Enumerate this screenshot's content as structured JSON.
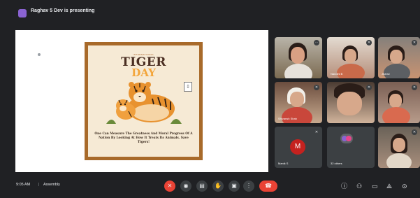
{
  "header": {
    "presenting_text": "Raghav 5 Dev is presenting"
  },
  "slide": {
    "poster_subtitle": "INTERNATIONAL",
    "poster_title_line1": "TIGER",
    "poster_title_line2": "DAY",
    "poster_caption": "One Can Measure The Greatness And Moral Progress Of A Nation By Looking At How It Treats Its Animals. Save Tigers!",
    "badge_icon": "slide-page-icon"
  },
  "participants": [
    {
      "name": "",
      "icon": "more-icon"
    },
    {
      "name": "Nandini B",
      "icon": "mic-off-icon"
    },
    {
      "name": "Jhanvi",
      "icon": "mic-off-icon"
    },
    {
      "name": "Shivansh Shah",
      "icon": "mic-off-icon"
    },
    {
      "name": "",
      "icon": "mic-off-icon"
    },
    {
      "name": "",
      "icon": "mic-off-icon"
    },
    {
      "name": "Manik S",
      "avatar_letter": "M",
      "icon": "mic-off-icon"
    },
    {
      "name": "32 others",
      "icon": "others-icon"
    },
    {
      "name": "",
      "icon": "mic-off-icon"
    }
  ],
  "footer": {
    "time": "9:05 AM",
    "separator": "|",
    "meeting_name": "Assembly"
  },
  "controls": [
    {
      "name": "mic-off-icon",
      "glyph": "✕"
    },
    {
      "name": "camera-icon",
      "glyph": "◉"
    },
    {
      "name": "captions-icon",
      "glyph": "▤"
    },
    {
      "name": "raise-hand-icon",
      "glyph": "✋"
    },
    {
      "name": "present-icon",
      "glyph": "▣"
    },
    {
      "name": "more-options-icon",
      "glyph": "⋮"
    },
    {
      "name": "end-call-icon",
      "glyph": "☎"
    }
  ],
  "right_icons": [
    {
      "name": "info-icon",
      "glyph": "ⓘ"
    },
    {
      "name": "people-icon",
      "glyph": "⚇"
    },
    {
      "name": "chat-icon",
      "glyph": "▭"
    },
    {
      "name": "activities-icon",
      "glyph": "⟁"
    },
    {
      "name": "host-controls-icon",
      "glyph": "⊙"
    }
  ],
  "colors": {
    "background": "#202124",
    "tile": "#3c4043",
    "danger": "#ea4335",
    "accent_purple": "#8a63d2"
  }
}
